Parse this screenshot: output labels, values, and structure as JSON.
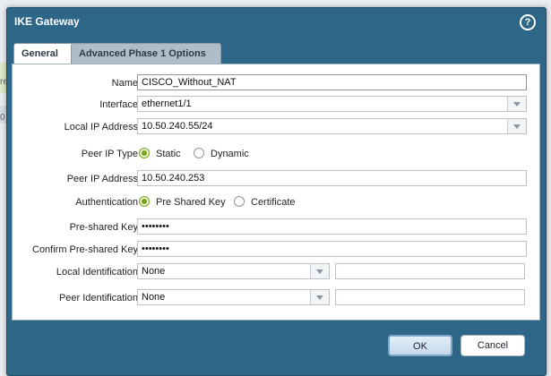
{
  "background": {
    "frag_top": "re",
    "frag_mid": "0"
  },
  "dialog": {
    "title": "IKE Gateway",
    "help_icon": "?",
    "tabs": [
      {
        "label": "General"
      },
      {
        "label": "Advanced Phase 1 Options"
      }
    ]
  },
  "form": {
    "name": {
      "label": "Name",
      "value": "CISCO_Without_NAT"
    },
    "interface": {
      "label": "Interface",
      "value": "ethernet1/1"
    },
    "local_ip": {
      "label": "Local IP Address",
      "value": "10.50.240.55/24"
    },
    "peer_ip_type": {
      "label": "Peer IP Type",
      "options": [
        "Static",
        "Dynamic"
      ],
      "selected": "Static"
    },
    "peer_ip": {
      "label": "Peer IP Address",
      "value": "10.50.240.253"
    },
    "authentication": {
      "label": "Authentication",
      "options": [
        "Pre Shared Key",
        "Certificate"
      ],
      "selected": "Pre Shared Key"
    },
    "psk": {
      "label": "Pre-shared Key",
      "value": "••••••••"
    },
    "confirm_psk": {
      "label": "Confirm Pre-shared Key",
      "value": "••••••••"
    },
    "local_id": {
      "label": "Local Identification",
      "value": "None",
      "text": ""
    },
    "peer_id": {
      "label": "Peer Identification",
      "value": "None",
      "text": ""
    }
  },
  "buttons": {
    "ok": "OK",
    "cancel": "Cancel"
  },
  "colors": {
    "titlebar": "#2e6688",
    "radio_selected": "#7aa21a"
  }
}
